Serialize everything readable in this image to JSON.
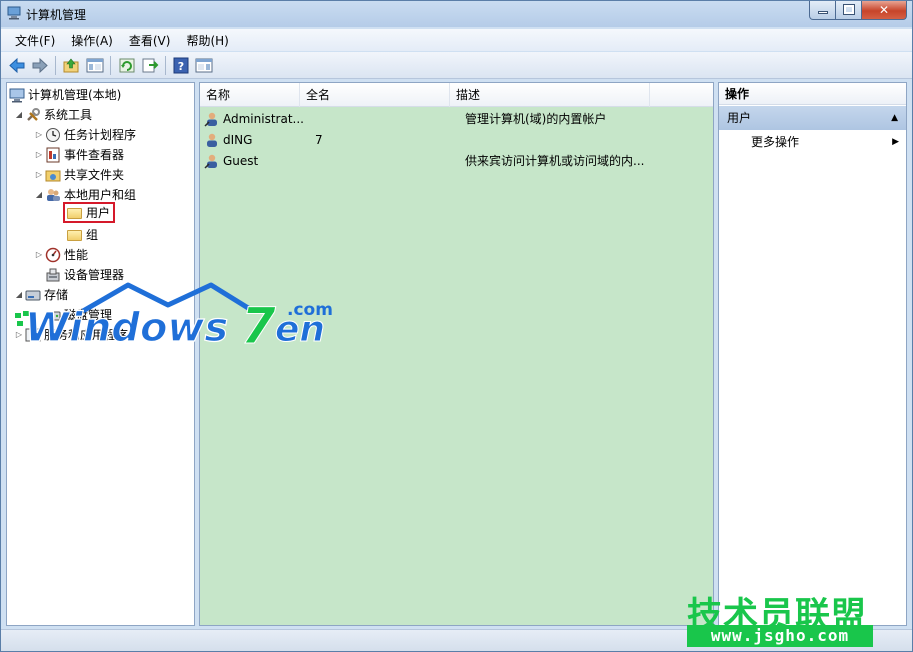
{
  "window": {
    "title": "计算机管理"
  },
  "menu": [
    "文件(F)",
    "操作(A)",
    "查看(V)",
    "帮助(H)"
  ],
  "toolbar": [
    "back-icon",
    "forward-icon",
    "up-folder-icon",
    "show-hide-tree-icon",
    "refresh-icon",
    "export-list-icon",
    "help-icon",
    "action-pane-icon"
  ],
  "tree": {
    "root": "计算机管理(本地)",
    "system_tools": "系统工具",
    "task_scheduler": "任务计划程序",
    "event_viewer": "事件查看器",
    "shared_folders": "共享文件夹",
    "local_users_groups": "本地用户和组",
    "users": "用户",
    "groups": "组",
    "performance": "性能",
    "device_manager": "设备管理器",
    "storage": "存储",
    "disk_management": "磁盘管理",
    "services_apps": "服务和应用程序"
  },
  "list": {
    "columns": [
      "名称",
      "全名",
      "描述"
    ],
    "rows": [
      {
        "name": "Administrat...",
        "fullname": "",
        "description": "管理计算机(域)的内置帐户"
      },
      {
        "name": "dING",
        "fullname": "7",
        "description": ""
      },
      {
        "name": "Guest",
        "fullname": "",
        "description": "供来宾访问计算机或访问域的内..."
      }
    ]
  },
  "actions": {
    "header": "操作",
    "section": "用户",
    "more": "更多操作"
  },
  "watermarks": {
    "logo1": "Windows7en",
    "logo1_suffix": ".com",
    "logo2": "技术员联盟",
    "logo2_url": "www.jsgho.com"
  },
  "colors": {
    "list_background": "#c6e6c9",
    "selection_outline": "#d5192a",
    "watermark_green": "#19c64b",
    "watermark_blue": "#1f6fd8"
  }
}
